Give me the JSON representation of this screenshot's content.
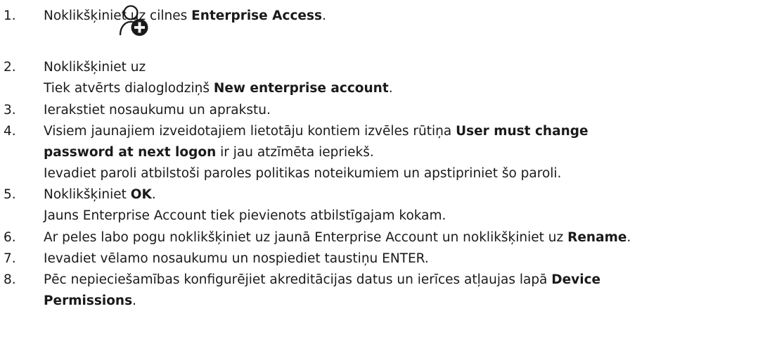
{
  "steps": [
    {
      "number": "1.",
      "lines": [
        {
          "t1": "Noklikšķiniet uz cilnes ",
          "b1": "Enterprise Access",
          "t2": "."
        }
      ]
    },
    {
      "number": "2.",
      "lines": [
        {
          "t1": "Noklikšķiniet uz",
          "after_icon": "."
        },
        {
          "t1": "Tiek atvērts dialoglodziņš ",
          "b1": "New enterprise account",
          "t2": "."
        }
      ],
      "icon": "add-user-icon"
    },
    {
      "number": "3.",
      "lines": [
        {
          "t1": "Ierakstiet nosaukumu un aprakstu."
        }
      ]
    },
    {
      "number": "4.",
      "lines": [
        {
          "t1": "Visiem jaunajiem izveidotajiem lietotāju kontiem izvēles rūtiņa ",
          "b1": "User must change"
        },
        {
          "b1": "password at next logon",
          "t2": " ir jau atzīmēta iepriekš."
        },
        {
          "t1": "Ievadiet paroli atbilstoši paroles politikas noteikumiem un apstipriniet šo paroli."
        }
      ]
    },
    {
      "number": "5.",
      "lines": [
        {
          "t1": "Noklikšķiniet ",
          "b1": "OK",
          "t2": "."
        },
        {
          "t1": "Jauns Enterprise Account tiek pievienots atbilstīgajam kokam."
        }
      ]
    },
    {
      "number": "6.",
      "lines": [
        {
          "t1": "Ar peles labo pogu noklikšķiniet uz jaunā Enterprise Account un noklikšķiniet uz ",
          "b1": "Rename",
          "t2": "."
        }
      ]
    },
    {
      "number": "7.",
      "lines": [
        {
          "t1": "Ievadiet vēlamo nosaukumu un nospiediet taustiņu ENTER."
        }
      ]
    },
    {
      "number": "8.",
      "lines": [
        {
          "t1": "Pēc nepieciešamības konfigurējiet akreditācijas datus un ierīces atļaujas lapā ",
          "b1": "Device"
        },
        {
          "b1": "Permissions",
          "t2": "."
        }
      ]
    }
  ]
}
